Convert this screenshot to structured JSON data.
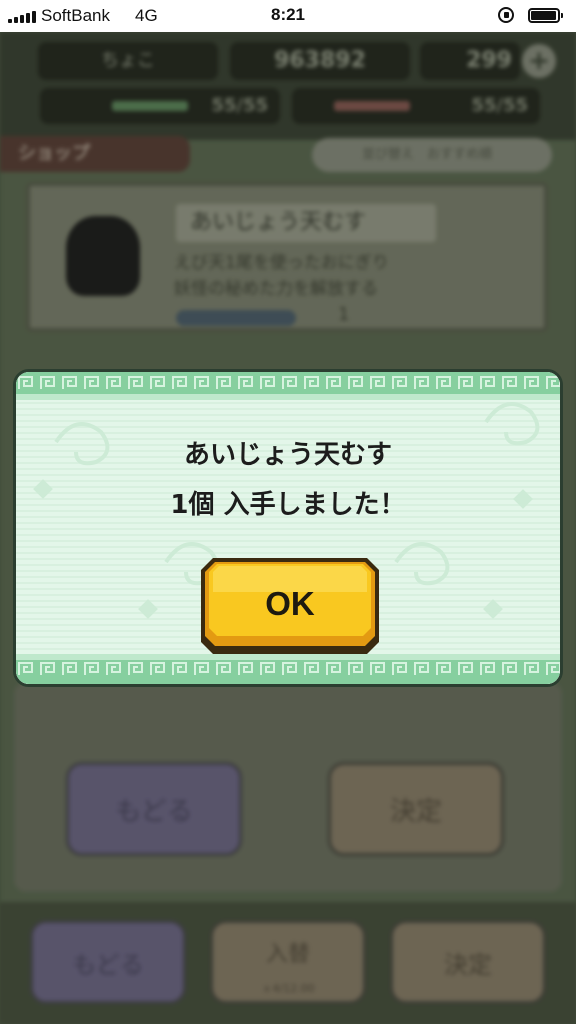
{
  "status_bar": {
    "carrier": "SoftBank",
    "network": "4G",
    "time": "8:21"
  },
  "background": {
    "player_name": "ちょこ",
    "coins": "963892",
    "gems": "299",
    "stamina_green": "55/55",
    "stamina_red": "55/55",
    "shop_tab": "ショップ",
    "sort_label": "並び替え　おすすめ順",
    "item_name": "あいじょう天むす",
    "item_description": "えび天1尾を使ったおにぎり\n妖怪の秘めた力を解放する",
    "item_quantity": "1",
    "back_label": "もどる",
    "confirm_label": "決定",
    "swap_label": "入替",
    "swap_cost": "ｘ4/12.00"
  },
  "dialog": {
    "line1": "あいじょう天むす",
    "line2": "1個  入手しました！",
    "ok_label": "OK"
  },
  "colors": {
    "dialog_bg": "#e2f6e8",
    "dialog_band": "#8fd4a6",
    "ok_fill": "#f6c21a",
    "ok_border": "#3a2a10"
  }
}
